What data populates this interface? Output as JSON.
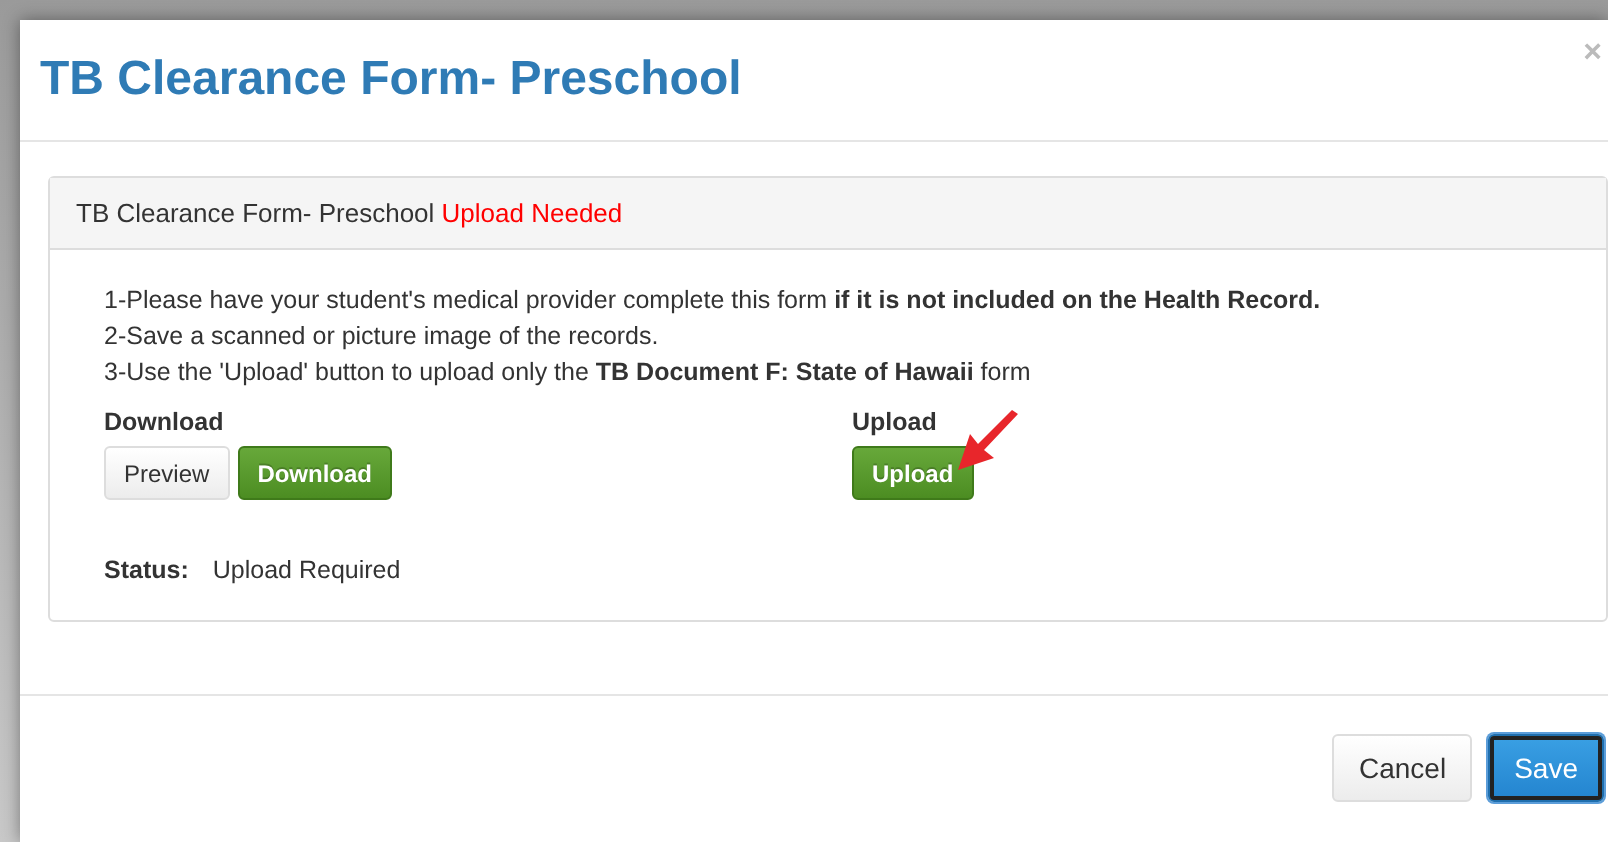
{
  "modal": {
    "title": "TB Clearance Form- Preschool",
    "close": "×"
  },
  "panel": {
    "heading": "TB Clearance Form- Preschool",
    "heading_status": "Upload Needed",
    "instructions": [
      "1-Please have your student's medical provider complete this form **if it is not included on the Health Record.**",
      "2-Save a scanned or picture image of the records.",
      "3-Use the 'Upload' button to upload only the **TB Document F:  State of Hawaii** form"
    ],
    "download": {
      "label": "Download",
      "buttons": [
        {
          "label": "Preview",
          "kind": "default"
        },
        {
          "label": "Download",
          "kind": "success"
        }
      ]
    },
    "upload": {
      "label": "Upload",
      "buttons": [
        {
          "label": "Upload",
          "kind": "success"
        }
      ]
    },
    "status": {
      "label": "Status:",
      "value": "Upload Required"
    }
  },
  "footer": {
    "buttons": [
      {
        "label": "Cancel",
        "kind": "default",
        "focused": false
      },
      {
        "label": "Save",
        "kind": "primary",
        "focused": true
      }
    ]
  }
}
